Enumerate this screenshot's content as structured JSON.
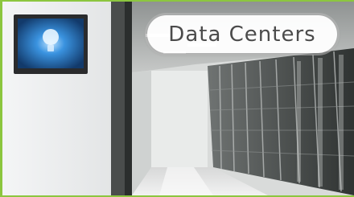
{
  "tile": {
    "label": "Data Centers"
  },
  "colors": {
    "accent_border": "#8cc63f",
    "label_text": "#4b4b4b",
    "screen_glow": "#2f86d8"
  },
  "icons": {
    "wall_screen": "monitor-icon",
    "screen_logo": "light-bulb-icon"
  }
}
